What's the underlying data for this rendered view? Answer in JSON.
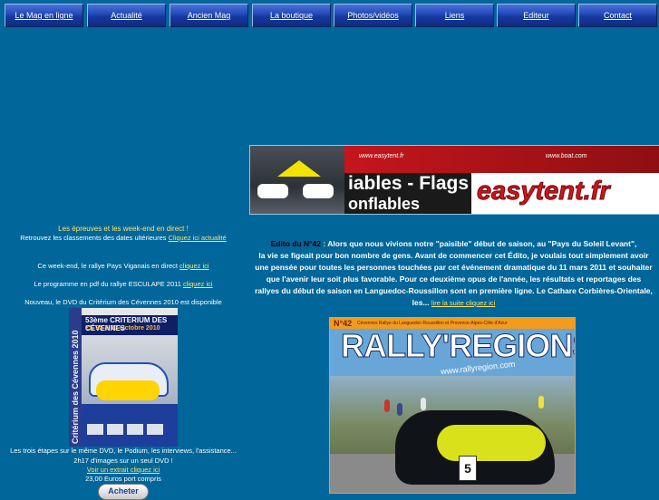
{
  "nav": {
    "items": [
      "Le Mag en ligne",
      "Actualité",
      "Ancien Mag",
      "La boutique",
      "Photos/vidéos",
      "Liens",
      "Editeur",
      "Contact"
    ]
  },
  "left": {
    "epreuves_title": "Les épreuves et les week-end en direct !",
    "retrouvez_text": "Retrouvez les classements des dates ultérieures",
    "retrouvez_link": "Cliquez ici actualité",
    "weekend_text": "Ce week-end, le rallye Pays Viganais en direct",
    "weekend_link": "cliquez ici",
    "programme_text": "Le programme en pdf du rallye ESCULAPE 2011",
    "programme_link": "cliquez ici",
    "dvd_text": "Nouveau, le DVD du Critérium des Cévennes 2010 est disponible",
    "dvd_cover": {
      "spine": "Critérium des Cévennes 2010",
      "banner_title": "53ème CRITERIUM DES CÉVENNES",
      "banner_dates": "21, 22 & 23 Octobre 2010"
    },
    "stages_text": "Les trois étapes sur le même DVD, le Podium, les interviews, l'assistance...",
    "duration_text": "2h17 d'images sur un seul DVD !",
    "extract_link": "Voir un extrait cliquez ici",
    "price": "23,00 Euros port compris",
    "buy_label": "Acheter"
  },
  "banner": {
    "text1": "iables - Flags",
    "text2": "onflables",
    "brand": "easytent.fr",
    "url_top1": "www.easytent.fr",
    "url_top2": "www.boat.com"
  },
  "edito": {
    "label": "Edito du N°42",
    "lines": [
      "Alors que nous vivions notre \"paisible\" début de saison, au \"Pays du Soleil Levant\",",
      "la vie se figeait pour bon nombre de gens. Avant de commencer cet Édito, je voulais tout simplement avoir",
      "une pensée pour toutes les personnes touchées par cet événement dramatique du 11 mars 2011 et souhaiter",
      "que l'avenir leur soit plus favorable. Pour ce deuxième opus de l'année, les résultats et reportages des",
      "rallyes du début de saison en Languedoc-Roussillon sont en première ligne. Le Cathare Corbières-Orientale,",
      "les..."
    ],
    "more_link": "lire la suite cliquez ici"
  },
  "magazine": {
    "number": "N°42",
    "header_text": "Cévennes Rallye du Languedoc-Roussillon et Provence-Alpes-Côte d'Azur",
    "title": "RALLY'REGIONS",
    "site": "www.rallyregion.com",
    "plate": "5"
  }
}
